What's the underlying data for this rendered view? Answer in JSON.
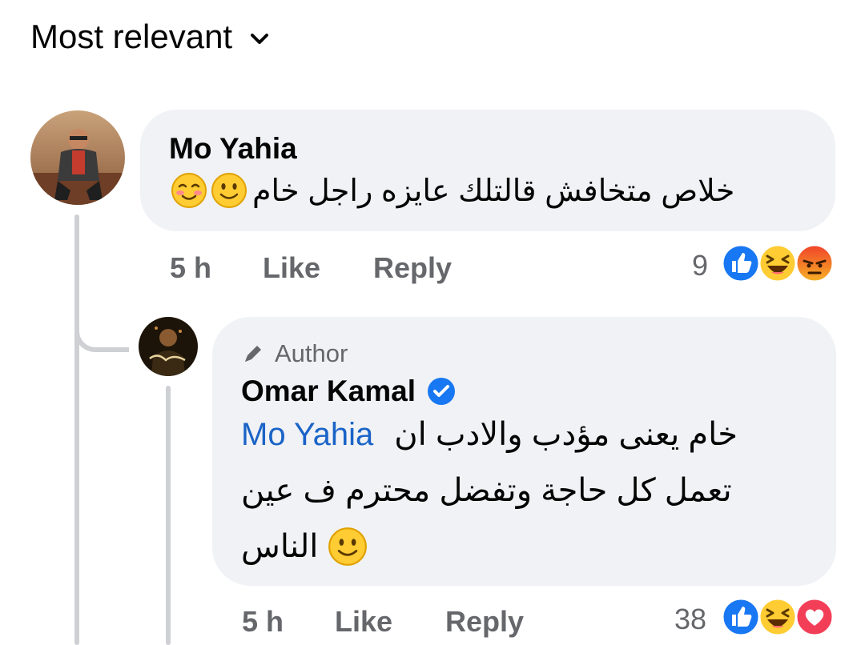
{
  "sort": {
    "label": "Most relevant"
  },
  "comment": {
    "author": "Mo Yahia",
    "text": "خلاص متخافش قالتلك عايزه راجل خام",
    "time": "5 h",
    "like": "Like",
    "reply": "Reply",
    "reaction_count": "9",
    "reactions": [
      "like-reaction-icon",
      "haha-reaction-icon",
      "angry-reaction-icon"
    ],
    "emojis": [
      "smiling-face-icon",
      "blushing-face-icon"
    ]
  },
  "reply": {
    "badge": "Author",
    "author": "Omar Kamal",
    "verified": true,
    "line1_text": "خام يعنى مؤدب والادب ان",
    "mention": "Mo Yahia",
    "line2": "تعمل كل حاجة وتفضل محترم ف عين",
    "line3": "الناس",
    "time": "5 h",
    "like": "Like",
    "reply": "Reply",
    "reaction_count": "38",
    "reactions": [
      "like-reaction-icon",
      "haha-reaction-icon",
      "love-reaction-icon"
    ]
  },
  "colors": {
    "accent": "#1877f2",
    "mention": "#1a63c7",
    "bubble": "#f0f2f5",
    "meta": "#65676b"
  }
}
